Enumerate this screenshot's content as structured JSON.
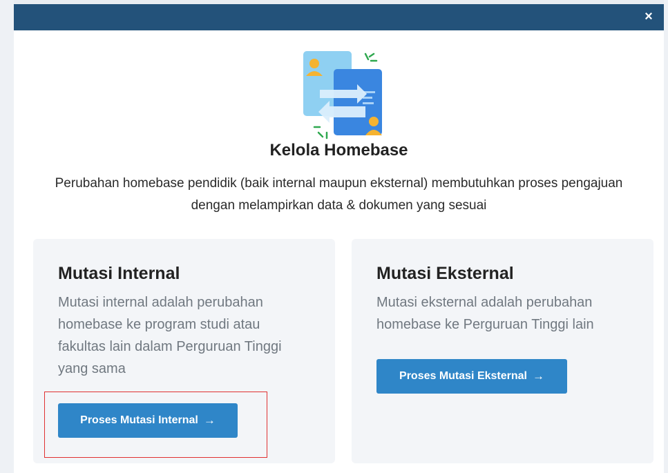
{
  "modal": {
    "close_label": "×",
    "title": "Kelola Homebase",
    "description": "Perubahan homebase pendidik (baik internal maupun eksternal) membutuhkan proses pengajuan dengan melampirkan data & dokumen yang sesuai",
    "hero_icon": "homebase-transfer-icon"
  },
  "cards": {
    "internal": {
      "title": "Mutasi Internal",
      "description": "Mutasi internal adalah perubahan homebase ke program studi atau fakultas lain dalam Perguruan Tinggi yang sama",
      "button_label": "Proses Mutasi Internal",
      "button_arrow": "→"
    },
    "external": {
      "title": "Mutasi Eksternal",
      "description": "Mutasi eksternal adalah perubahan homebase ke Perguruan Tinggi lain",
      "button_label": "Proses Mutasi Eksternal",
      "button_arrow": "→"
    }
  },
  "colors": {
    "header": "#23527a",
    "button": "#2f86c8",
    "card_bg": "#f3f5f8",
    "highlight": "#e03030"
  }
}
